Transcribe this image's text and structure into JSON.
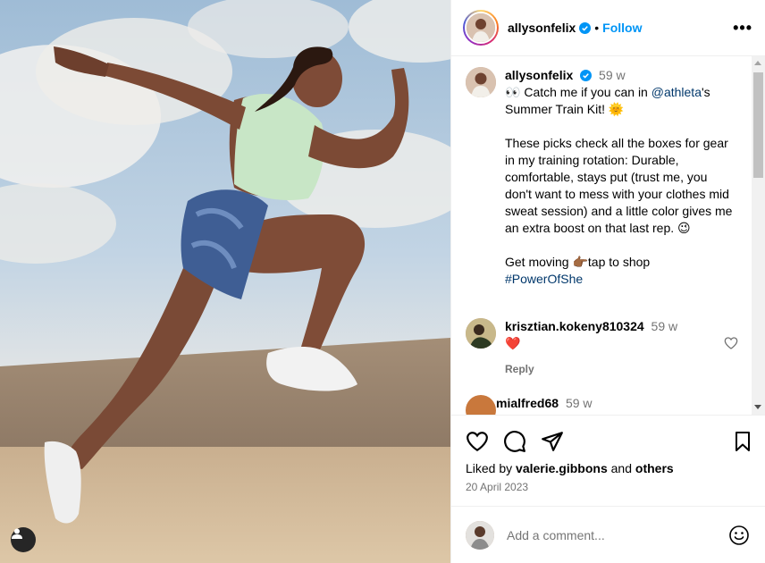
{
  "post": {
    "username": "allysonfelix",
    "follow_label": "Follow",
    "more_label": "•••",
    "caption": {
      "username": "allysonfelix",
      "time": "59 w",
      "line1_emoji": "👀",
      "line1_pre": "Catch me if you can in ",
      "mention": "@athleta",
      "line1_post": "'s Summer Train Kit! 🌞",
      "para2": "These picks check all the boxes for gear in my training rotation: Durable, comfortable, stays put (trust me, you don't want to mess with your clothes mid sweat session) and a little color gives me an extra boost on that last rep. 😉",
      "para3_line": "Get moving 👉🏾tap to shop",
      "hashtag": "#PowerOfShe"
    },
    "comments": [
      {
        "username": "krisztian.kokeny810324",
        "time": "59 w",
        "text": "❤️",
        "reply_label": "Reply"
      },
      {
        "username": "mialfred68",
        "time": "59 w"
      }
    ],
    "liked_by_prefix": "Liked by ",
    "liked_by_user": "valerie.gibbons",
    "liked_by_and": " and ",
    "liked_by_others": "others",
    "date": "20 April 2023",
    "comment_placeholder": "Add a comment..."
  },
  "colors": {
    "accent": "#0095f6",
    "verified": "#0095f6",
    "muted": "#737373"
  },
  "icons": [
    "verified-badge-icon",
    "heart-icon",
    "comment-icon",
    "share-icon",
    "bookmark-icon",
    "emoji-icon",
    "user-tag-icon"
  ]
}
